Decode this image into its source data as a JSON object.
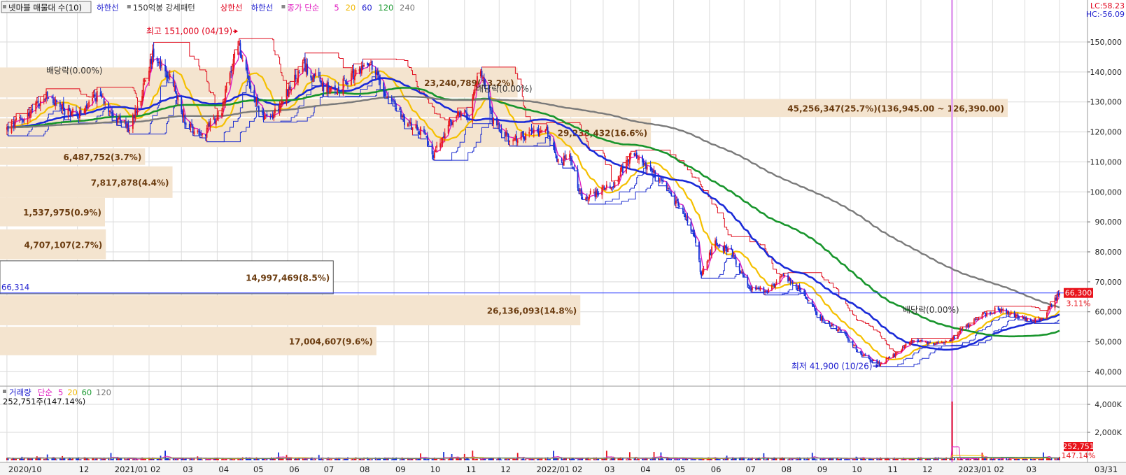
{
  "header": {
    "stock_label": "넷마블 매물대 수(10)",
    "items": [
      {
        "text": "하한선",
        "color": "#1f1fcf"
      },
      {
        "text": "150억봉 강세패턴",
        "color": "#333333"
      },
      {
        "text": "상한선",
        "color": "#e0001a"
      },
      {
        "text": "하한선",
        "color": "#1f1fcf"
      },
      {
        "text": "종가 단순",
        "color": "#e020c0"
      },
      {
        "text": "5",
        "color": "#e020c0"
      },
      {
        "text": "20",
        "color": "#f0b800"
      },
      {
        "text": "60",
        "color": "#1f1fcf"
      },
      {
        "text": "120",
        "color": "#1a9a30"
      },
      {
        "text": "240",
        "color": "#777777"
      }
    ]
  },
  "corner": {
    "lc": "LC:58.23",
    "hc": "HC:-56.09"
  },
  "colors": {
    "up": "#e8141c",
    "down": "#1530d8",
    "ma5": "#e020c0",
    "ma20": "#f5c000",
    "ma60": "#1a2ad8",
    "ma120": "#18952c",
    "ma240": "#7a7a7a",
    "profile": "#f4e4cf",
    "upper_band": "#e01020",
    "lower_band": "#2030d0"
  },
  "annotations": {
    "high": "최고 151,000 (04/19)",
    "low": "최저 41,900 (10/26)",
    "dividend": "배당락(0.00%)",
    "current_line_label": "66,314",
    "price_tag": "66,300",
    "price_change": "3.11%"
  },
  "volume_panel": {
    "legend": [
      {
        "text": "거래량",
        "color": "#1f1fcf"
      },
      {
        "text": "단순",
        "color": "#e020c0"
      },
      {
        "text": "5",
        "color": "#e020c0"
      },
      {
        "text": "20",
        "color": "#f0b800"
      },
      {
        "text": "60",
        "color": "#1a9a30"
      },
      {
        "text": "120",
        "color": "#777777"
      }
    ],
    "summary": "252,751주(147.14%)",
    "tag_volume": "252,751",
    "tag_pct": "147.14%"
  },
  "chart_data": {
    "type": "candlestick",
    "price_axis": {
      "ylim": [
        38000,
        157000
      ],
      "ticks": [
        40000,
        50000,
        60000,
        70000,
        80000,
        90000,
        100000,
        110000,
        120000,
        130000,
        140000
      ],
      "tick_labels": [
        "40,000",
        "50,000",
        "60,000",
        "70,000",
        "80,000",
        "90,000",
        "100,000",
        "110,000",
        "120,000",
        "130,000",
        "140,000",
        "150,000"
      ]
    },
    "volume_axis": {
      "ylim": [
        0,
        4500
      ],
      "ticks": [
        2000,
        4000
      ],
      "tick_labels": [
        "2,000K",
        "4,000K"
      ]
    },
    "x_axis_labels": [
      {
        "label": "2020/10",
        "date": "2020-10"
      },
      {
        "label": "12",
        "date": "2020-12"
      },
      {
        "label": "2021/01",
        "date": "2021-01"
      },
      {
        "label": "02",
        "date": "2021-02"
      },
      {
        "label": "03",
        "date": "2021-03"
      },
      {
        "label": "04",
        "date": "2021-04"
      },
      {
        "label": "05",
        "date": "2021-05"
      },
      {
        "label": "06",
        "date": "2021-06"
      },
      {
        "label": "07",
        "date": "2021-07"
      },
      {
        "label": "08",
        "date": "2021-08"
      },
      {
        "label": "09",
        "date": "2021-09"
      },
      {
        "label": "10",
        "date": "2021-10"
      },
      {
        "label": "11",
        "date": "2021-11"
      },
      {
        "label": "12",
        "date": "2021-12"
      },
      {
        "label": "2022/01",
        "date": "2022-01"
      },
      {
        "label": "02",
        "date": "2022-02"
      },
      {
        "label": "03",
        "date": "2022-03"
      },
      {
        "label": "04",
        "date": "2022-04"
      },
      {
        "label": "05",
        "date": "2022-05"
      },
      {
        "label": "06",
        "date": "2022-06"
      },
      {
        "label": "07",
        "date": "2022-07"
      },
      {
        "label": "08",
        "date": "2022-08"
      },
      {
        "label": "09",
        "date": "2022-09"
      },
      {
        "label": "10",
        "date": "2022-10"
      },
      {
        "label": "11",
        "date": "2022-11"
      },
      {
        "label": "12",
        "date": "2022-12"
      },
      {
        "label": "2023/01",
        "date": "2023-01"
      },
      {
        "label": "02",
        "date": "2023-02"
      },
      {
        "label": "03",
        "date": "2023-03"
      },
      {
        "label": "03/31",
        "date": "2023-03-31"
      }
    ],
    "volume_profile": [
      {
        "price_low": 125000,
        "price_high": 131000,
        "label": "45,256,347(25.7%)(136,945.00 ~ 126,390.00)"
      },
      {
        "price_low": 115000,
        "price_high": 124500,
        "label": "29,238,432(16.6%)"
      },
      {
        "price_low": 131500,
        "price_high": 141500,
        "label": "23,240,789(13.2%)"
      },
      {
        "price_low": 109000,
        "price_high": 114500,
        "label": "6,487,752(3.7%)"
      },
      {
        "price_low": 98000,
        "price_high": 108500,
        "label": "7,817,878(4.4%)"
      },
      {
        "price_low": 88500,
        "price_high": 98000,
        "label": "1,537,975(0.9%)"
      },
      {
        "price_low": 77500,
        "price_high": 87500,
        "label": "4,707,107(2.7%)"
      },
      {
        "price_low": 66000,
        "price_high": 77000,
        "label": "14,997,469(8.5%)"
      },
      {
        "price_low": 55500,
        "price_high": 65500,
        "label": "26,136,093(14.8%)"
      },
      {
        "price_low": 45500,
        "price_high": 55000,
        "label": "17,004,607(9.6%)"
      }
    ],
    "price_anchors": [
      [
        "2020-10-01",
        121000
      ],
      [
        "2020-10-20",
        126000
      ],
      [
        "2020-11-05",
        132000
      ],
      [
        "2020-11-20",
        127000
      ],
      [
        "2020-12-05",
        126000
      ],
      [
        "2020-12-20",
        133000
      ],
      [
        "2021-01-05",
        124000
      ],
      [
        "2021-01-15",
        121000
      ],
      [
        "2021-01-25",
        132000
      ],
      [
        "2021-02-05",
        147000
      ],
      [
        "2021-02-20",
        137000
      ],
      [
        "2021-03-05",
        123000
      ],
      [
        "2021-03-20",
        119000
      ],
      [
        "2021-04-05",
        128000
      ],
      [
        "2021-04-19",
        150000
      ],
      [
        "2021-04-30",
        133000
      ],
      [
        "2021-05-15",
        123000
      ],
      [
        "2021-05-31",
        133000
      ],
      [
        "2021-06-15",
        142000
      ],
      [
        "2021-06-30",
        136000
      ],
      [
        "2021-07-10",
        133000
      ],
      [
        "2021-07-31",
        140000
      ],
      [
        "2021-08-10",
        144000
      ],
      [
        "2021-08-25",
        133000
      ],
      [
        "2021-09-10",
        124000
      ],
      [
        "2021-09-25",
        120000
      ],
      [
        "2021-10-05",
        112000
      ],
      [
        "2021-10-20",
        124000
      ],
      [
        "2021-11-05",
        126000
      ],
      [
        "2021-11-15",
        142000
      ],
      [
        "2021-11-25",
        124000
      ],
      [
        "2021-12-10",
        117000
      ],
      [
        "2021-12-31",
        120000
      ],
      [
        "2022-01-10",
        122000
      ],
      [
        "2022-01-20",
        110000
      ],
      [
        "2022-01-31",
        111000
      ],
      [
        "2022-02-10",
        98000
      ],
      [
        "2022-02-25",
        100000
      ],
      [
        "2022-03-10",
        103000
      ],
      [
        "2022-03-25",
        112000
      ],
      [
        "2022-04-05",
        110000
      ],
      [
        "2022-04-20",
        103000
      ],
      [
        "2022-05-10",
        93000
      ],
      [
        "2022-05-20",
        83000
      ],
      [
        "2022-05-25",
        72000
      ],
      [
        "2022-06-05",
        83000
      ],
      [
        "2022-06-20",
        80000
      ],
      [
        "2022-07-05",
        68000
      ],
      [
        "2022-07-20",
        67000
      ],
      [
        "2022-08-05",
        72000
      ],
      [
        "2022-08-20",
        67000
      ],
      [
        "2022-09-05",
        58000
      ],
      [
        "2022-09-25",
        53000
      ],
      [
        "2022-10-10",
        46000
      ],
      [
        "2022-10-26",
        42500
      ],
      [
        "2022-11-10",
        46000
      ],
      [
        "2022-11-25",
        51000
      ],
      [
        "2022-12-10",
        49000
      ],
      [
        "2022-12-25",
        50000
      ],
      [
        "2023-01-05",
        54000
      ],
      [
        "2023-01-20",
        58000
      ],
      [
        "2023-02-05",
        61000
      ],
      [
        "2023-02-20",
        59000
      ],
      [
        "2023-03-05",
        57000
      ],
      [
        "2023-03-15",
        57500
      ],
      [
        "2023-03-31",
        66300
      ]
    ],
    "current_price": 66300,
    "high": {
      "date": "2021-04-19",
      "value": 151000
    },
    "low": {
      "date": "2022-10-26",
      "value": 41900
    },
    "vertical_marker_date": "2022-12-28",
    "volume_spike": {
      "date": "2022-12-28",
      "value": 4200
    }
  }
}
